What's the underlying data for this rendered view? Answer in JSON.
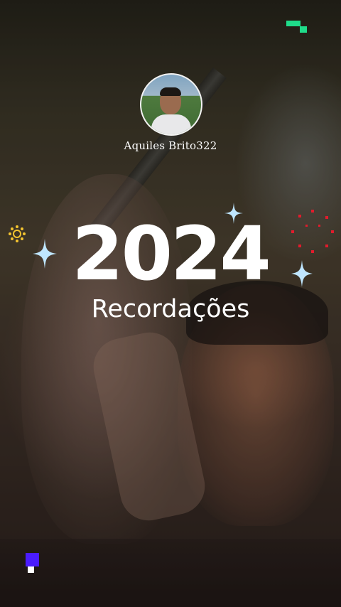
{
  "profile": {
    "username": "Aquiles Brito322"
  },
  "headline": {
    "year": "2024",
    "subtitle": "Recordações"
  },
  "colors": {
    "accent_green": "#1fdc8a",
    "accent_purple": "#4a1cff",
    "sparkle_blue": "#bfe6ff",
    "sparkle_gold": "#f4c430",
    "dots_red": "#e21b2c",
    "text": "#ffffff"
  },
  "icons": [
    "sparkle-icon",
    "sun-icon",
    "red-dots-burst-icon"
  ]
}
